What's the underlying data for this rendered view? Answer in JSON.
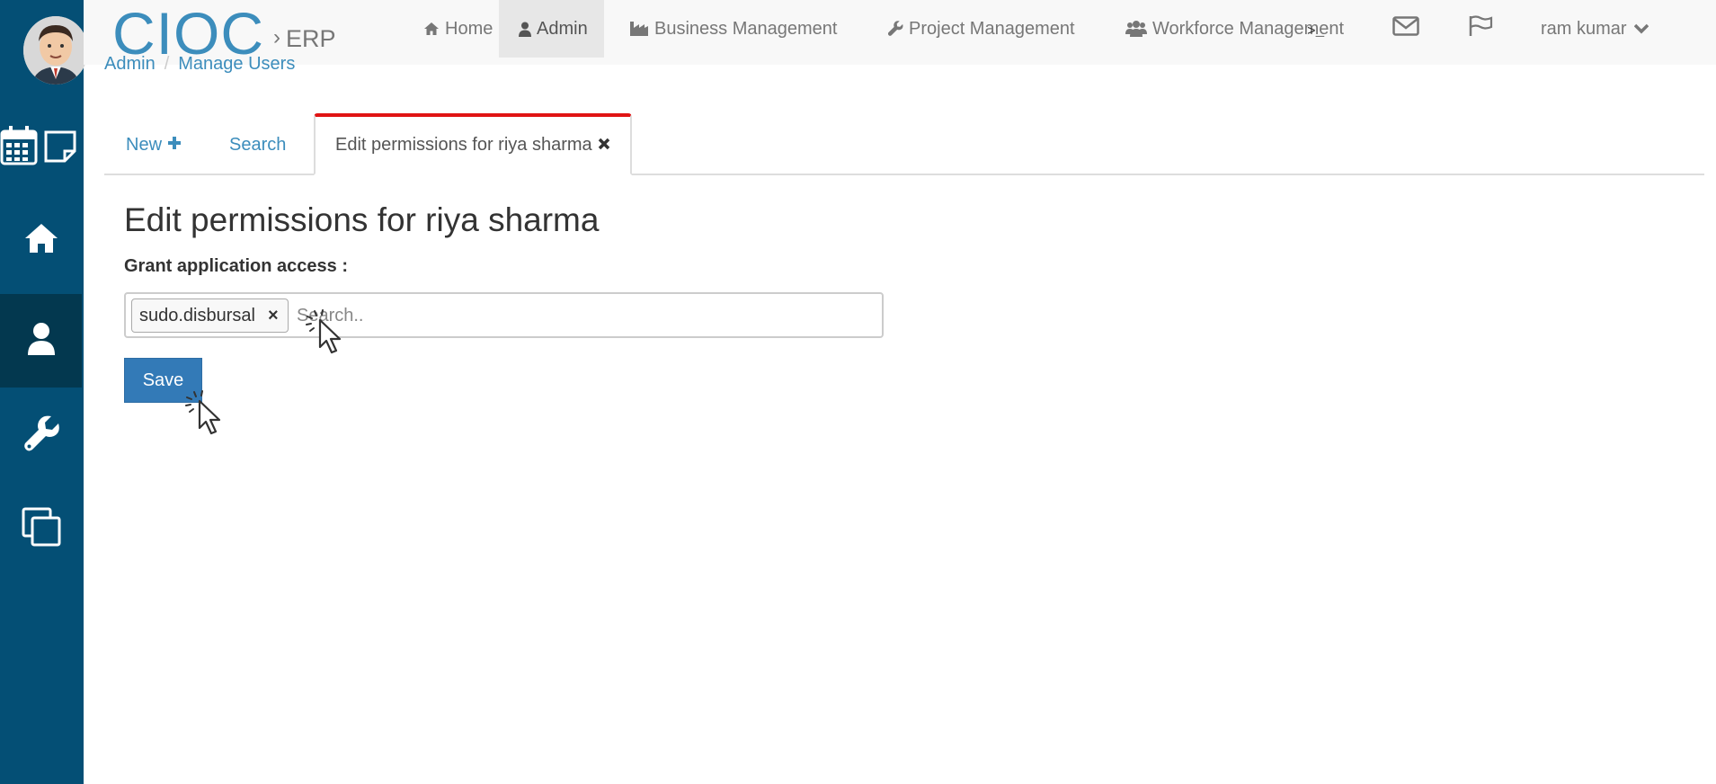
{
  "brand": {
    "name": "CIOC",
    "separator": "›",
    "product": "ERP"
  },
  "nav": {
    "home": "Home",
    "admin": "Admin",
    "business": "Business Management",
    "project": "Project Management",
    "workforce": "Workforce Management",
    "user": "ram kumar"
  },
  "breadcrumb": {
    "first": "Admin",
    "sep": "/",
    "second": "Manage Users"
  },
  "tabs": {
    "new": "New",
    "search": "Search",
    "edit": "Edit permissions for riya sharma"
  },
  "main": {
    "title": "Edit permissions for riya sharma",
    "grant_label": "Grant application access :",
    "selected_app": "sudo.disbursal",
    "chip_remove": "×",
    "search_placeholder": "Search..",
    "save_label": "Save"
  },
  "terminal_glyph": ">_",
  "colors": {
    "sidebar": "#044f75",
    "sidebar_active": "#03384f",
    "brand": "#3c8dbc",
    "primary_button": "#337ab7",
    "active_tab_accent": "#e01414"
  }
}
